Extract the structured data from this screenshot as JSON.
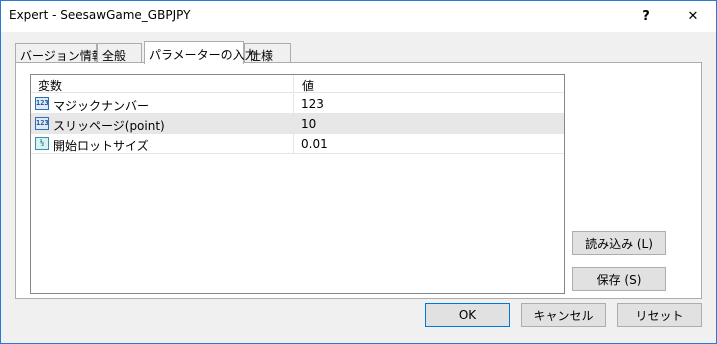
{
  "window": {
    "title": "Expert - SeesawGame_GBPJPY",
    "help_label": "?",
    "close_label": "✕"
  },
  "tabs": [
    {
      "label": "バージョン情報",
      "active": false
    },
    {
      "label": "全般",
      "active": false
    },
    {
      "label": "パラメーターの入力",
      "active": true
    },
    {
      "label": "仕様",
      "active": false
    }
  ],
  "table": {
    "headers": {
      "variable": "変数",
      "value": "値"
    },
    "rows": [
      {
        "icon": "integer-icon",
        "icon_text": "123",
        "name": "マジックナンバー",
        "value": "123"
      },
      {
        "icon": "integer-icon",
        "icon_text": "123",
        "name": "スリッページ(point)",
        "value": "10"
      },
      {
        "icon": "double-icon",
        "icon_text": "½",
        "name": "開始ロットサイズ",
        "value": "0.01"
      }
    ]
  },
  "side_buttons": {
    "load": "読み込み (L)",
    "save": "保存 (S)"
  },
  "footer_buttons": {
    "ok": "OK",
    "cancel": "キャンセル",
    "reset": "リセット"
  }
}
